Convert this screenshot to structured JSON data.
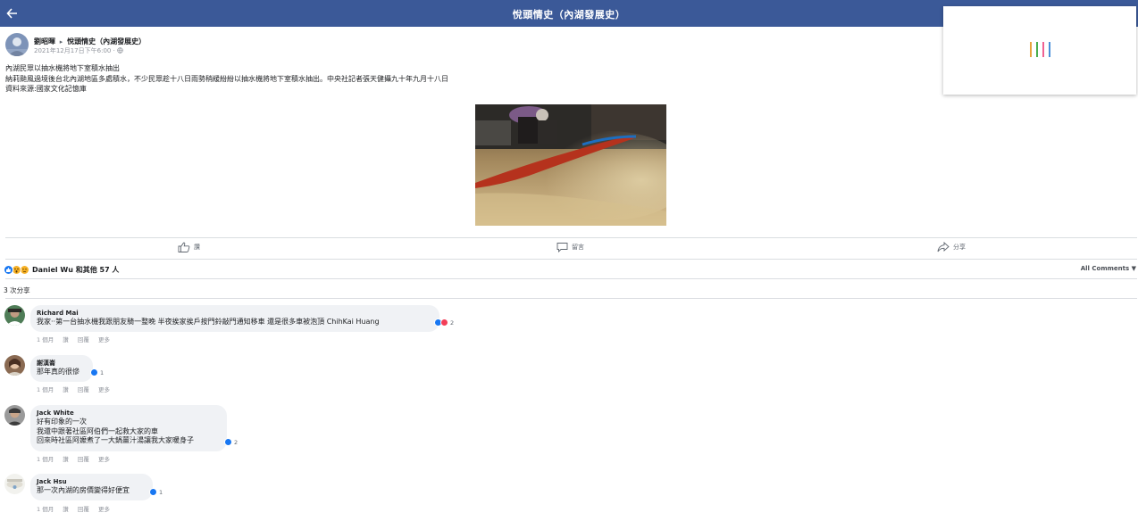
{
  "header": {
    "title": "悅頭情史（內湖發展史）",
    "back_icon": "back-arrow-icon",
    "background": "#3b5998"
  },
  "loader": {
    "colors": [
      "#e8a33d",
      "#4caf50",
      "#f06292",
      "#4a90d9"
    ]
  },
  "post": {
    "author": "劉昭暉",
    "group": "悅頭情史（內湖發展史）",
    "meta": "2021年12月17日下午6:00 · ",
    "lines": [
      "內湖民眾以抽水機將地下室積水抽出",
      "納莉颱風過境後台北內湖地區多處積水，不少民眾趁十八日雨勢稍緩紛紛以抽水機將地下室積水抽出。中央社記者張天健攝九十年九月十八日",
      "資料來源:國家文化記憶庫"
    ]
  },
  "actions": {
    "like": "讚",
    "comment": "留言",
    "share": "分享"
  },
  "reactions": {
    "summary": "Daniel Wu 和其他 57 人",
    "all_comments": "All Comments ▼",
    "shares": "3 次分享"
  },
  "comments": [
    {
      "name": "Richard Mai",
      "lines": [
        "我家··第一台抽水機我跟朋友騎一整晚 半夜挨家挨戶按門鈴敲門通知移車 還是很多車被泡頂 ChihKai Huang"
      ],
      "count": "2",
      "time": "1 個月",
      "like": "讚",
      "reply": "回覆",
      "more": "更多"
    },
    {
      "name": "謝漢崙",
      "lines": [
        "那年真的很慘"
      ],
      "count": "1",
      "time": "1 個月",
      "like": "讚",
      "reply": "回覆",
      "more": "更多"
    },
    {
      "name": "Jack White",
      "lines": [
        "好有印象的一次",
        "我還中跟著社區阿伯們一起救大家的車",
        "回來時社區阿嬤煮了一大鍋薑汁湯讓我大家暖身子"
      ],
      "count": "2",
      "time": "1 個月",
      "like": "讚",
      "reply": "回覆",
      "more": "更多"
    },
    {
      "name": "Jack Hsu",
      "lines": [
        "那一次內湖的房價變得好便宜"
      ],
      "count": "1",
      "time": "1 個月",
      "like": "讚",
      "reply": "回覆",
      "more": "更多"
    }
  ],
  "colors": {
    "accent": "#3b5998",
    "like_blue": "#1877f2",
    "love_red": "#f33e58",
    "wow_yellow": "#f7b125",
    "bubble": "#f0f2f5"
  }
}
